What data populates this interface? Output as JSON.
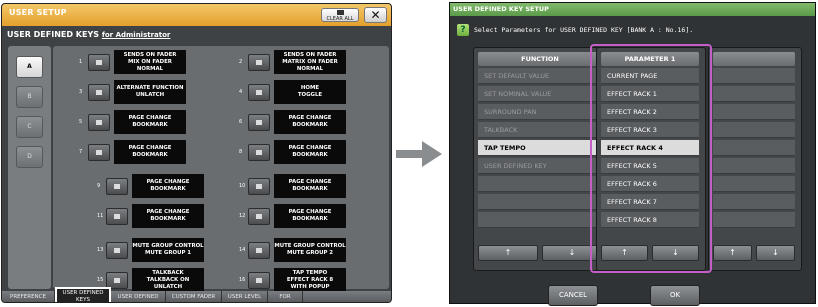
{
  "left_panel": {
    "title": "USER SETUP",
    "clear_all_label": "CLEAR ALL",
    "subheading": "USER DEFINED KEYS",
    "subheading_link": "for Administrator",
    "banks": [
      "A",
      "B",
      "C",
      "D"
    ],
    "keys": [
      {
        "n": "1",
        "lines": "SENDS ON FADER\nMIX ON FADER\nNORMAL"
      },
      {
        "n": "2",
        "lines": "SENDS ON FADER\nMATRIX ON FADER\nNORMAL"
      },
      {
        "n": "3",
        "lines": "ALTERNATE FUNCTION\nUNLATCH"
      },
      {
        "n": "4",
        "lines": "HOME\nTOGGLE"
      },
      {
        "n": "5",
        "lines": "PAGE CHANGE\nBOOKMARK"
      },
      {
        "n": "6",
        "lines": "PAGE CHANGE\nBOOKMARK"
      },
      {
        "n": "7",
        "lines": "PAGE CHANGE\nBOOKMARK"
      },
      {
        "n": "8",
        "lines": "PAGE CHANGE\nBOOKMARK"
      },
      {
        "n": "9",
        "lines": "PAGE CHANGE\nBOOKMARK"
      },
      {
        "n": "10",
        "lines": "PAGE CHANGE\nBOOKMARK"
      },
      {
        "n": "11",
        "lines": "PAGE CHANGE\nBOOKMARK"
      },
      {
        "n": "12",
        "lines": "PAGE CHANGE\nBOOKMARK"
      },
      {
        "n": "13",
        "lines": "MUTE GROUP CONTROL\nMUTE GROUP 1"
      },
      {
        "n": "14",
        "lines": "MUTE GROUP CONTROL\nMUTE GROUP 2"
      },
      {
        "n": "15",
        "lines": "TALKBACK\nTALKBACK ON\nUNLATCH"
      },
      {
        "n": "16",
        "lines": "TAP TEMPO\nEFFECT RACK 8\nWITH POPUP"
      }
    ],
    "tabs": [
      {
        "label": "PREFERENCE"
      },
      {
        "label": "USER DEFINED\nKEYS"
      },
      {
        "label": "USER DEFINED\nKNOBS"
      },
      {
        "label": "CUSTOM FADER"
      },
      {
        "label": "USER LEVEL"
      },
      {
        "label": "FOR\nGUEST"
      }
    ]
  },
  "right_panel": {
    "title": "USER DEFINED KEY SETUP",
    "prompt": "Select Parameters for USER DEFINED KEY [BANK A : No.16].",
    "function_header": "FUNCTION",
    "parameter_header": "PARAMETER 1",
    "functions": [
      "SET DEFAULT VALUE",
      "SET NOMINAL VALUE",
      "SURROUND PAN",
      "TALKBACK",
      "TAP TEMPO",
      "USER DEFINED KEY"
    ],
    "selected_function": "TAP TEMPO",
    "parameters": [
      "CURRENT PAGE",
      "EFFECT RACK 1",
      "EFFECT RACK 2",
      "EFFECT RACK 3",
      "EFFECT RACK 4",
      "EFFECT RACK 5",
      "EFFECT RACK 6",
      "EFFECT RACK 7",
      "EFFECT RACK 8"
    ],
    "selected_parameter": "EFFECT RACK 4",
    "cancel_label": "CANCEL",
    "ok_label": "OK"
  }
}
